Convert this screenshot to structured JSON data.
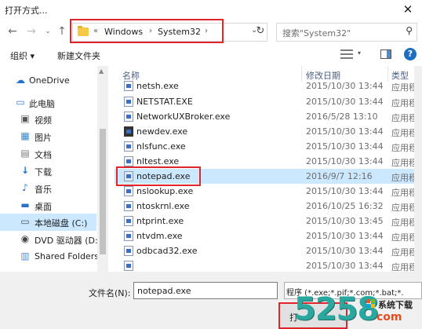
{
  "window": {
    "title": "打开方式..."
  },
  "address_bar": {
    "crumbs": [
      "Windows",
      "System32"
    ],
    "prefix": "«",
    "separator": "›"
  },
  "search": {
    "placeholder": "搜索\"System32\""
  },
  "toolbar": {
    "organize_label": "组织 ▾",
    "new_folder_label": "新建文件夹"
  },
  "nav_pane": {
    "items": [
      {
        "label": "OneDrive",
        "icon": "cloud-icon"
      },
      {
        "label": "此电脑",
        "icon": "computer-icon"
      },
      {
        "label": "视频",
        "icon": "video-icon"
      },
      {
        "label": "图片",
        "icon": "picture-icon"
      },
      {
        "label": "文档",
        "icon": "document-icon"
      },
      {
        "label": "下载",
        "icon": "download-icon"
      },
      {
        "label": "音乐",
        "icon": "music-icon"
      },
      {
        "label": "桌面",
        "icon": "desktop-icon"
      },
      {
        "label": "本地磁盘 (C:)",
        "icon": "drive-icon",
        "selected": true
      },
      {
        "label": "DVD 驱动器 (D:",
        "icon": "dvd-icon"
      },
      {
        "label": "Shared Folders",
        "icon": "network-folder-icon"
      }
    ]
  },
  "file_list": {
    "columns": [
      "名称",
      "修改日期",
      "类型"
    ],
    "rows": [
      {
        "name": "netsh.exe",
        "date": "2015/10/30 13:44",
        "type": "应用程"
      },
      {
        "name": "NETSTAT.EXE",
        "date": "2015/10/30 13:44",
        "type": "应用程"
      },
      {
        "name": "NetworkUXBroker.exe",
        "date": "2016/5/28 13:10",
        "type": "应用程"
      },
      {
        "name": "newdev.exe",
        "date": "2015/10/30 13:44",
        "type": "应用程"
      },
      {
        "name": "nlsfunc.exe",
        "date": "2015/10/30 13:44",
        "type": "应用程"
      },
      {
        "name": "nltest.exe",
        "date": "2015/10/30 13:44",
        "type": "应用程"
      },
      {
        "name": "notepad.exe",
        "date": "2016/9/7 12:16",
        "type": "应用程",
        "selected": true
      },
      {
        "name": "nslookup.exe",
        "date": "2015/10/30 13:44",
        "type": "应用程"
      },
      {
        "name": "ntoskrnl.exe",
        "date": "2016/10/25 16:32",
        "type": "应用程"
      },
      {
        "name": "ntprint.exe",
        "date": "2015/10/30 13:45",
        "type": "应用程"
      },
      {
        "name": "ntvdm.exe",
        "date": "2015/10/30 13:44",
        "type": "应用程"
      },
      {
        "name": "odbcad32.exe",
        "date": "2015/10/30 13:44",
        "type": "应用程"
      },
      {
        "name": "",
        "date": "2015/10/30 13:44",
        "type": "应用程"
      }
    ]
  },
  "footer": {
    "filename_label": "文件名(N):",
    "filename_value": "notepad.exe",
    "filter_value": "程序 (*.exe;*.pif;*.com;*.bat;*.",
    "open_label": "打"
  },
  "watermark": {
    "number": "5258",
    "line1": "系统下载",
    "line2": "com"
  },
  "colors": {
    "selection": "#cce8ff",
    "highlight_border": "#e0262b",
    "accent": "#1b6ec2"
  }
}
